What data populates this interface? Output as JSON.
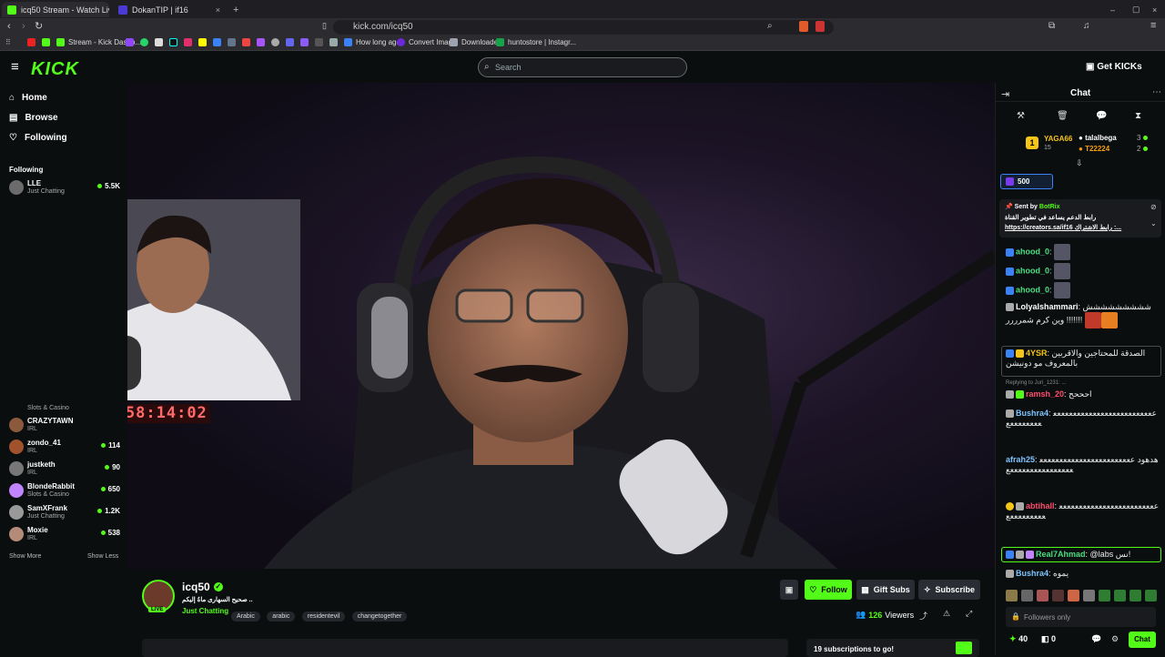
{
  "browser": {
    "tabs": [
      {
        "title": "icq50 Stream - Watch Live on Ki",
        "active": true
      },
      {
        "title": "DokanTIP | if16",
        "active": false
      }
    ],
    "url": "kick.com/icq50",
    "bookmarks": [
      "Stream - Kick Dashb...",
      "How long ago",
      "Convert Image",
      "Downloader",
      "huntostore | Instagr..."
    ]
  },
  "header": {
    "logo": "KICK",
    "search_placeholder": "Search",
    "get_kicks": "Get KICKs"
  },
  "sidebar": {
    "nav": [
      {
        "label": "Home",
        "icon": "home-icon"
      },
      {
        "label": "Browse",
        "icon": "browse-icon"
      },
      {
        "label": "Following",
        "icon": "heart-icon"
      }
    ],
    "following_title": "Following",
    "top_channel": {
      "name": "LLE",
      "category": "Just Chatting",
      "viewers": "5.5K"
    },
    "channels": [
      {
        "name": "CRAZYTAWN",
        "category": "IRL",
        "viewers": ""
      },
      {
        "name": "zondo_41",
        "category": "IRL",
        "viewers": "114"
      },
      {
        "name": "justketh",
        "category": "IRL",
        "viewers": "90"
      },
      {
        "name": "BlondeRabbit",
        "category": "Slots & Casino",
        "viewers": "650"
      },
      {
        "name": "SamXFrank",
        "category": "Just Chatting",
        "viewers": "1.2K"
      },
      {
        "name": "Moxie",
        "category": "IRL",
        "viewers": "538"
      }
    ],
    "partial_category": "Slots & Casino",
    "show_more": "Show More",
    "show_less": "Show Less"
  },
  "video": {
    "timer": "47:58:14:02"
  },
  "stream_info": {
    "channel": "icq50",
    "title": "صحيح السهارى ماهُ إليكم ..",
    "category": "Just Chatting",
    "tags": [
      "Arabic",
      "arabic",
      "residentevil",
      "changetogether"
    ],
    "live_label": "LIVE",
    "viewers": "126",
    "viewers_label": "Viewers",
    "follow": "Follow",
    "gift_subs": "Gift Subs",
    "subscribe": "Subscribe",
    "sub_goal": "19 subscriptions to go!"
  },
  "chat": {
    "title": "Chat",
    "leaderboard": {
      "first": {
        "rank": "1",
        "name": "YAGA66",
        "count": "15"
      },
      "second": {
        "name": "talalbega",
        "count": "3"
      },
      "third": {
        "name": "T22224",
        "count": "2"
      }
    },
    "kicks_amount": "500",
    "pinned": {
      "sent_by": "Sent by",
      "bot": "BotRix",
      "line1": "رابط الدعم يساعد في تطوير القناة",
      "line2": "https://creators.sa/if16 رابط الاشتراك :..."
    },
    "messages": [
      {
        "user": "ahood_0",
        "color": "#4ade80",
        "text": ""
      },
      {
        "user": "ahood_0",
        "color": "#4ade80",
        "text": ""
      },
      {
        "user": "ahood_0",
        "color": "#4ade80",
        "text": ""
      },
      {
        "user": "Lolyalshammari",
        "color": "#ffffff",
        "text": "ششششششششش !!!!!!! وين كرم شمرررر"
      },
      {
        "user": "4YSR",
        "color": "#f5c518",
        "text": "الصدقة للمحتاجين والاقربين بالمعروف مو دونيشن"
      },
      {
        "user": "ramsh_20",
        "color": "#ff4d6d",
        "text": "احححح",
        "reply": "Replying to Juri_1231: ..."
      },
      {
        "user": "Bushra4",
        "color": "#7cc4ff",
        "text": "ععععععععععععععععععععععععععععععععععع"
      },
      {
        "user": "afrah25",
        "color": "#7cc4ff",
        "text": "هدهود ععععععععععععععععععععععععععععععععععععععععع"
      },
      {
        "user": "abtihall",
        "color": "#ff4d6d",
        "text": "ععععععععععععععععععععععععععععععععععع"
      },
      {
        "user": "Real7Ahmad",
        "color": "#4ade80",
        "text": "@labs نس!"
      },
      {
        "user": "Bushra4",
        "color": "#7cc4ff",
        "text": "يموه"
      }
    ],
    "followers_only": "Followers only",
    "kicks_balance": "40",
    "points": "0",
    "send": "Chat"
  }
}
